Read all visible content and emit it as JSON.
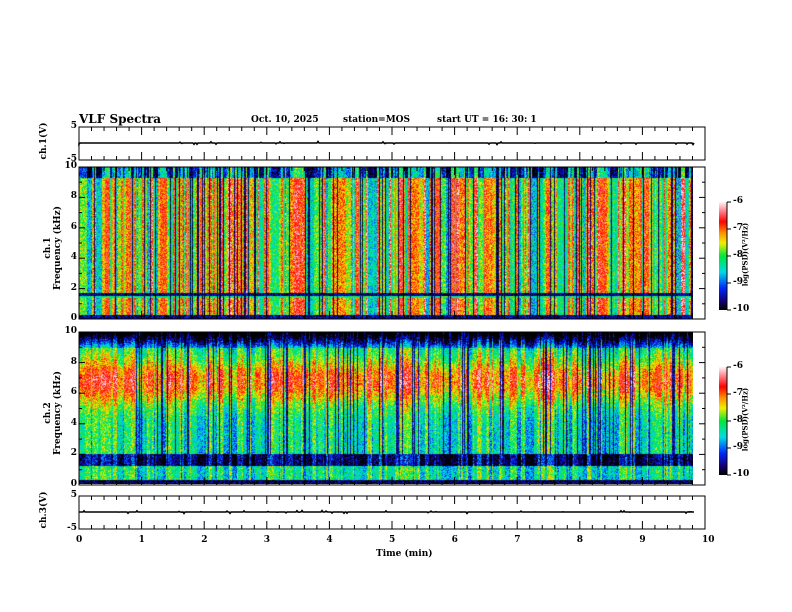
{
  "header": {
    "title": "VLF Spectra",
    "date": "Oct. 10, 2025",
    "station": "station=MOS",
    "start": "start  UT =   16: 30: 1"
  },
  "chart_data": [
    {
      "type": "line",
      "name": "ch1 waveform",
      "ylabel": "ch.1(V)",
      "ylim": [
        -5,
        5
      ],
      "yticks": [
        "5",
        "-5"
      ],
      "xlim": [
        0,
        10
      ],
      "values_description_level": 0
    },
    {
      "type": "heatmap",
      "name": "ch1 spectrogram",
      "ylabel_top": "ch.1",
      "ylabel": "Frequency (kHz)",
      "ylim": [
        0,
        10
      ],
      "yticks": [
        "0",
        "2",
        "4",
        "6",
        "8",
        "10"
      ],
      "xlim": [
        0,
        10
      ],
      "colorbar": {
        "label": "log(PSD)(V²/Hz)",
        "range": [
          -10,
          -6
        ],
        "ticks": [
          "-6",
          "-7",
          "-8",
          "-9",
          "-10"
        ]
      }
    },
    {
      "type": "heatmap",
      "name": "ch2 spectrogram",
      "ylabel_top": "ch.2",
      "ylabel": "Frequency (kHz)",
      "ylim": [
        0,
        10
      ],
      "yticks": [
        "0",
        "2",
        "4",
        "6",
        "8",
        "10"
      ],
      "xlim": [
        0,
        10
      ],
      "colorbar": {
        "label": "log(PSD)(V²/Hz)",
        "range": [
          -10,
          -6
        ],
        "ticks": [
          "-6",
          "-7",
          "-8",
          "-9",
          "-10"
        ]
      }
    },
    {
      "type": "line",
      "name": "ch3 waveform",
      "ylabel": "ch.3(V)",
      "ylim": [
        -5,
        5
      ],
      "yticks": [
        "5",
        "-5"
      ],
      "xlim": [
        0,
        10
      ]
    }
  ],
  "xaxis": {
    "label": "Time (min)",
    "ticks": [
      "0",
      "1",
      "2",
      "3",
      "4",
      "5",
      "6",
      "7",
      "8",
      "9",
      "10"
    ],
    "data_end": 9.83
  }
}
